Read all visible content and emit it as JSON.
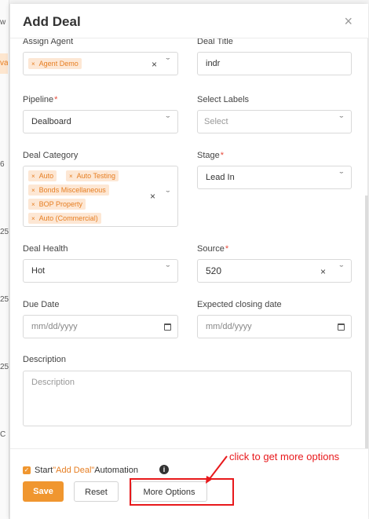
{
  "background": {
    "fragments": [
      "w",
      "va",
      "6",
      "25",
      "25",
      "25",
      "C"
    ]
  },
  "modal": {
    "title": "Add Deal",
    "close_label": "×"
  },
  "fields": {
    "assign_agent": {
      "label": "Assign Agent",
      "tags": [
        "Agent Demo"
      ]
    },
    "deal_title": {
      "label": "Deal Title",
      "value": "indr"
    },
    "pipeline": {
      "label": "Pipeline",
      "required": "*",
      "value": "Dealboard"
    },
    "select_labels": {
      "label": "Select Labels",
      "placeholder": "Select"
    },
    "deal_category": {
      "label": "Deal Category",
      "tags": [
        "Auto",
        "Auto Testing",
        "Bonds Miscellaneous",
        "BOP Property",
        "Auto (Commercial)"
      ]
    },
    "stage": {
      "label": "Stage",
      "required": "*",
      "value": "Lead In"
    },
    "deal_health": {
      "label": "Deal Health",
      "value": "Hot"
    },
    "source": {
      "label": "Source",
      "required": "*",
      "value": "520"
    },
    "due_date": {
      "label": "Due Date",
      "placeholder": "mm/dd/yyyy"
    },
    "expected_closing_date": {
      "label": "Expected closing date",
      "placeholder": "mm/dd/yyyy"
    },
    "description": {
      "label": "Description",
      "placeholder": "Description"
    }
  },
  "footer": {
    "automation_prefix": "Start",
    "automation_highlight": "\"Add Deal\"",
    "automation_suffix": "Automation",
    "info_icon": "i",
    "save_label": "Save",
    "reset_label": "Reset",
    "more_options_label": "More Options"
  },
  "annotation": {
    "text": "click to get more options",
    "color": "#e8191c"
  },
  "colors": {
    "accent": "#f0962f",
    "tag_bg": "#fde7d4",
    "tag_text": "#e67e22",
    "required": "#e74c3c"
  }
}
